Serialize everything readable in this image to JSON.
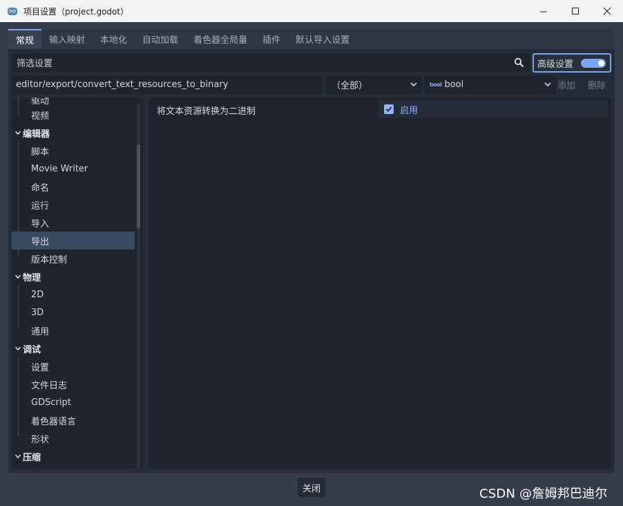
{
  "window": {
    "title": "项目设置（project.godot）"
  },
  "tabs": [
    {
      "label": "常规"
    },
    {
      "label": "输入映射"
    },
    {
      "label": "本地化"
    },
    {
      "label": "自动加载"
    },
    {
      "label": "着色器全局量"
    },
    {
      "label": "插件"
    },
    {
      "label": "默认导入设置"
    }
  ],
  "filter": {
    "placeholder": "筛选设置",
    "advanced_label": "高级设置",
    "advanced_on": true
  },
  "property_bar": {
    "path": "editor/export/convert_text_resources_to_binary",
    "scope": "（全部）",
    "type_icon": "bool",
    "type": "bool",
    "add_label": "添加",
    "delete_label": "删除"
  },
  "tree": {
    "rows": [
      {
        "label": "驱动",
        "kind": "child"
      },
      {
        "label": "视频",
        "kind": "child"
      },
      {
        "label": "编辑器",
        "kind": "section"
      },
      {
        "label": "脚本",
        "kind": "child"
      },
      {
        "label": "Movie Writer",
        "kind": "child"
      },
      {
        "label": "命名",
        "kind": "child"
      },
      {
        "label": "运行",
        "kind": "child"
      },
      {
        "label": "导入",
        "kind": "child"
      },
      {
        "label": "导出",
        "kind": "child",
        "selected": true
      },
      {
        "label": "版本控制",
        "kind": "child"
      },
      {
        "label": "物理",
        "kind": "section"
      },
      {
        "label": "2D",
        "kind": "child"
      },
      {
        "label": "3D",
        "kind": "child"
      },
      {
        "label": "通用",
        "kind": "child"
      },
      {
        "label": "调试",
        "kind": "section"
      },
      {
        "label": "设置",
        "kind": "child"
      },
      {
        "label": "文件日志",
        "kind": "child"
      },
      {
        "label": "GDScript",
        "kind": "child"
      },
      {
        "label": "着色器语言",
        "kind": "child"
      },
      {
        "label": "形状",
        "kind": "child"
      },
      {
        "label": "压缩",
        "kind": "section"
      }
    ]
  },
  "setting": {
    "label": "将文本资源转换为二进制",
    "value_label": "启用",
    "checked": true
  },
  "footer": {
    "close_label": "关闭"
  },
  "watermark": "CSDN @詹姆邦巴迪尔",
  "colors": {
    "accent": "#78a6f0",
    "background": "#363d4a",
    "panel": "#262c37",
    "field": "#1f242d"
  }
}
